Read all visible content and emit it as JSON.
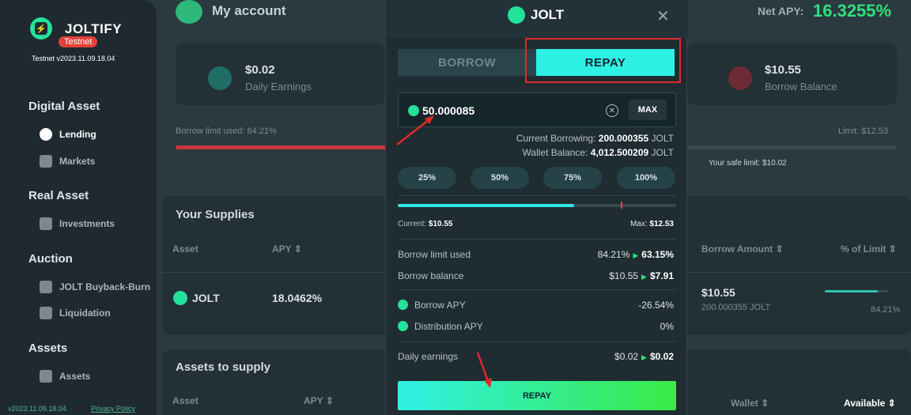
{
  "sidebar": {
    "brand": "JOLTIFY",
    "badge": "Testnet",
    "version": "Testnet v2023.11.09.18.04",
    "sections": {
      "digital": "Digital Asset",
      "real": "Real Asset",
      "auction": "Auction",
      "assets": "Assets"
    },
    "items": {
      "lending": "Lending",
      "markets": "Markets",
      "investments": "Investments",
      "buyback": "JOLT Buyback-Burn",
      "liquidation": "Liquidation",
      "assets": "Assets"
    },
    "footer_version": "v2023.11.09.18.04",
    "privacy": "Privacy Policy"
  },
  "account": {
    "title": "My account",
    "daily_earnings_value": "$0.02",
    "daily_earnings_label": "Daily Earnings",
    "borrow_balance_value": "$10.55",
    "borrow_balance_label": "Borrow Balance",
    "net_apy_label": "Net APY:",
    "net_apy_value": "16.3255%",
    "borrow_limit_used": "Borrow limit used: 84.21%",
    "limit": "Limit: $12.53",
    "safe_limit": "Your safe limit: $10.02",
    "borrow_limit_pct": 84.21
  },
  "supplies": {
    "title": "Your Supplies",
    "col_asset": "Asset",
    "col_apy": "APY",
    "row_asset": "JOLT",
    "row_apy": "18.0462%"
  },
  "borrows": {
    "col_amount": "Borrow Amount",
    "col_limit": "% of Limit",
    "row_amount": "$10.55",
    "row_amount_sub": "200.000355 JOLT",
    "row_limit": "84.21%",
    "row_limit_pct": 84.21
  },
  "to_supply": {
    "title": "Assets to supply",
    "col_asset": "Asset",
    "col_apy": "APY",
    "col_wallet": "Wallet",
    "col_available": "Available"
  },
  "modal": {
    "title": "JOLT",
    "tab_borrow": "BORROW",
    "tab_repay": "REPAY",
    "amount": "50.000085",
    "max": "MAX",
    "current_borrowing_label": "Current Borrowing:",
    "current_borrowing_value": "200.000355",
    "current_borrowing_unit": "JOLT",
    "wallet_balance_label": "Wallet Balance:",
    "wallet_balance_value": "4,012.500209",
    "wallet_balance_unit": "JOLT",
    "pct_buttons": [
      "25%",
      "50%",
      "75%",
      "100%"
    ],
    "current_label": "Current:",
    "current_value": "$10.55",
    "max_label": "Max:",
    "max_value": "$12.53",
    "slider_current_fraction": 0.6345,
    "slider_limit_fraction": 0.801,
    "borrow_limit_used_label": "Borrow limit used",
    "borrow_limit_used_from": "84.21%",
    "borrow_limit_used_to": "63.15%",
    "borrow_balance_label": "Borrow balance",
    "borrow_balance_from": "$10.55",
    "borrow_balance_to": "$7.91",
    "borrow_apy_label": "Borrow APY",
    "borrow_apy_value": "-26.54%",
    "distribution_apy_label": "Distribution APY",
    "distribution_apy_value": "0%",
    "daily_earnings_label": "Daily earnings",
    "daily_earnings_from": "$0.02",
    "daily_earnings_to": "$0.02",
    "repay_button": "REPAY"
  },
  "colors": {
    "accent_cyan": "#2ef1e6",
    "accent_green": "#23e29a",
    "danger_red": "#e5413c",
    "annotation_red": "#e02a2a"
  }
}
